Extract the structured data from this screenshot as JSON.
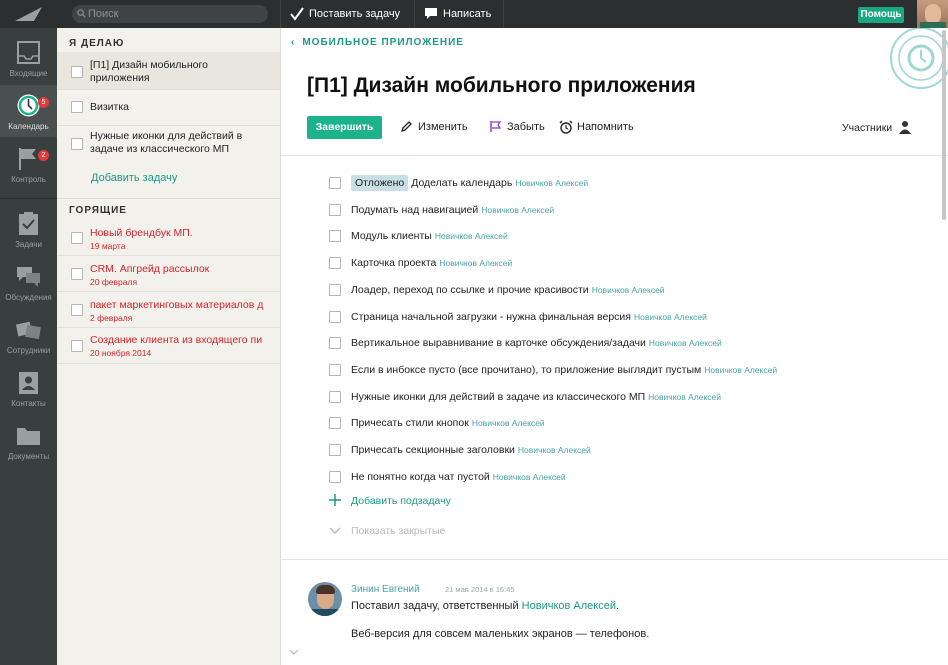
{
  "topbar": {
    "search_placeholder": "Поиск",
    "new_task_label": "Поставить задачу",
    "write_label": "Написать",
    "help_label": "Помощь"
  },
  "sidenav": {
    "items": [
      {
        "label": "Входящие",
        "icon": "inbox-icon"
      },
      {
        "label": "Календарь",
        "icon": "clock-icon",
        "badge": "5"
      },
      {
        "label": "Контроль",
        "icon": "flag-icon",
        "badge": "2"
      },
      {
        "label": "Задачи",
        "icon": "clipboard-icon"
      },
      {
        "label": "Обсуждения",
        "icon": "chat-bubbles-icon"
      },
      {
        "label": "Сотрудники",
        "icon": "people-icon"
      },
      {
        "label": "Контакты",
        "icon": "contact-card-icon"
      },
      {
        "label": "Документы",
        "icon": "folder-icon"
      }
    ]
  },
  "tasklist": {
    "doing_header": "Я ДЕЛАЮ",
    "doing": [
      {
        "text": "[П1] Дизайн мобильного приложения"
      },
      {
        "text": "Визитка"
      },
      {
        "text": "Нужные иконки для действий в задаче из классического МП"
      }
    ],
    "add_task": "Добавить задачу",
    "burning_header": "ГОРЯЩИЕ",
    "burning": [
      {
        "text": "Новый брендбук МП.",
        "date": "19 марта"
      },
      {
        "text": "CRM. Апгрейд рассылок",
        "date": "20 февраля"
      },
      {
        "text": "пакет маркетинговых материалов д",
        "date": "2 февраля"
      },
      {
        "text": "Создание клиента из входящего пи",
        "date": "20 ноября 2014"
      }
    ]
  },
  "task": {
    "breadcrumb": "МОБИЛЬНОЕ ПРИЛОЖЕНИЕ",
    "title": "[П1] Дизайн мобильного приложения",
    "actions": {
      "complete": "Завершить",
      "edit": "Изменить",
      "forget": "Забыть",
      "remind": "Напомнить",
      "members": "Участники"
    },
    "subtasks": [
      {
        "tag": "Отложено",
        "text": "Доделать календарь",
        "assignee": "Новичков Алексей"
      },
      {
        "tag": "",
        "text": "Подумать над навигацией",
        "assignee": "Новичков Алексей"
      },
      {
        "tag": "",
        "text": "Модуль клиенты",
        "assignee": "Новичков Алексей"
      },
      {
        "tag": "",
        "text": "Карточка проекта",
        "assignee": "Новичков Алексей"
      },
      {
        "tag": "",
        "text": "Лоадер, переход по ссылке и прочие красивости",
        "assignee": "Новичков Алексей"
      },
      {
        "tag": "",
        "text": "Страница начальной загрузки - нужна финальная версия",
        "assignee": "Новичков Алексей"
      },
      {
        "tag": "",
        "text": "Вертикальное выравнивание в карточке обсуждения/задачи",
        "assignee": "Новичков Алексей"
      },
      {
        "tag": "",
        "text": "Если в инбоксе пусто (все прочитано), то приложение выглядит пустым",
        "assignee": "Новичков Алексей"
      },
      {
        "tag": "",
        "text": "Нужные иконки для действий в задаче из классического МП",
        "assignee": "Новичков Алексей"
      },
      {
        "tag": "",
        "text": "Причесать стили кнопок",
        "assignee": "Новичков Алексей"
      },
      {
        "tag": "",
        "text": "Причесать секционные заголовки",
        "assignee": "Новичков Алексей"
      },
      {
        "tag": "",
        "text": "Не понятно когда чат пустой",
        "assignee": "Новичков Алексей"
      }
    ],
    "add_subtask": "Добавить подзадачу",
    "show_closed": "Показать закрытые"
  },
  "comment": {
    "author": "Зинин Евгений",
    "date": "21 мая 2014 в 16:45",
    "text_prefix": "Поставил задачу, ответственный",
    "text_link": "Новичков Алексей",
    "text_suffix": ".",
    "text2": "Веб-версия для совсем маленьких экранов — телефонов."
  },
  "colors": {
    "accent": "#1bb28c",
    "link": "#1a9a86",
    "urgent": "#d5232b",
    "topbar": "#2b2f2f",
    "sidenav": "#393e3e",
    "listpanel": "#f2f1ec"
  }
}
